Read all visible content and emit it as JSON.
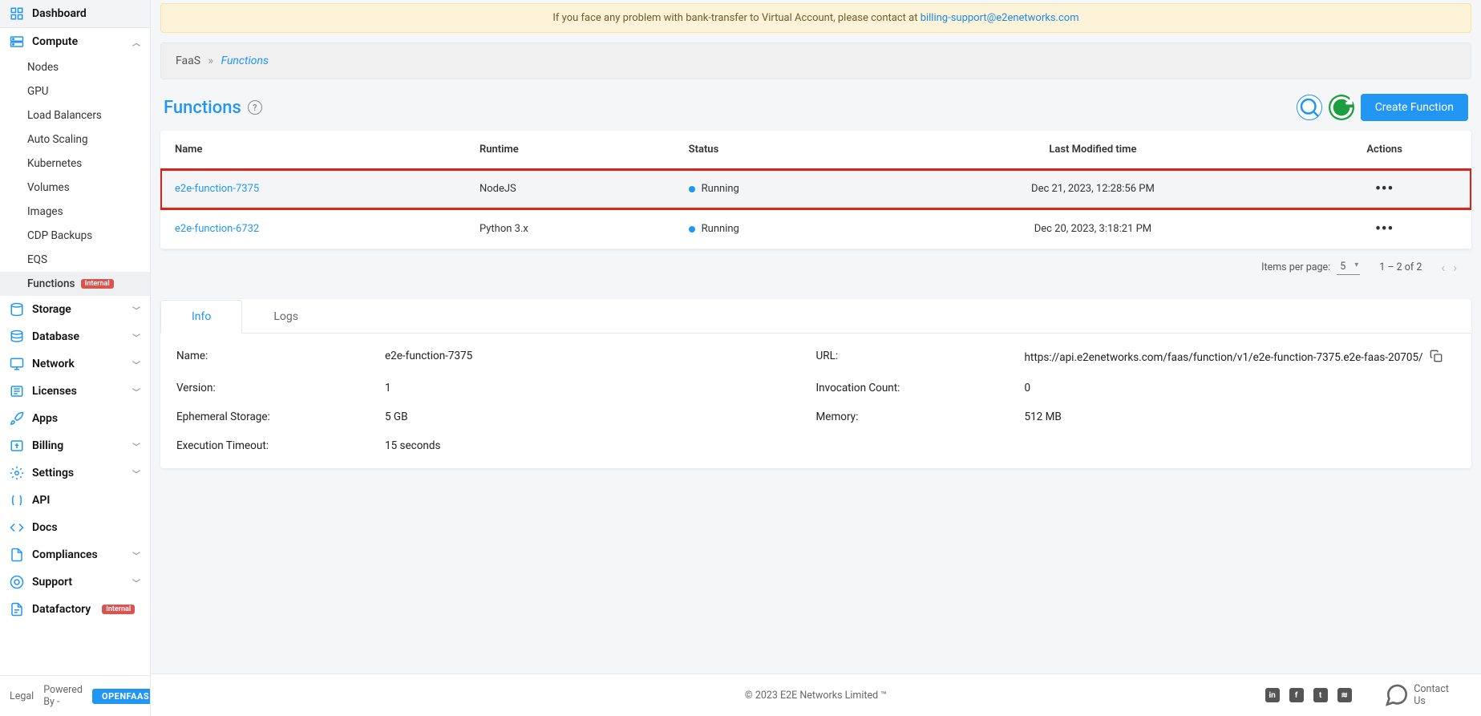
{
  "notice": {
    "text": "If you face any problem with bank-transfer to Virtual Account, please contact at ",
    "email": "billing-support@e2enetworks.com"
  },
  "sidebar": {
    "dashboard": "Dashboard",
    "compute": {
      "label": "Compute",
      "items": [
        "Nodes",
        "GPU",
        "Load Balancers",
        "Auto Scaling",
        "Kubernetes",
        "Volumes",
        "Images",
        "CDP Backups",
        "EQS",
        "Functions"
      ],
      "functions_badge": "Internal"
    },
    "storage": "Storage",
    "database": "Database",
    "network": "Network",
    "licenses": "Licenses",
    "apps": "Apps",
    "billing": "Billing",
    "settings": "Settings",
    "api": "API",
    "docs": "Docs",
    "compliances": "Compliances",
    "support": "Support",
    "datafactory": "Datafactory",
    "datafactory_badge": "Internal"
  },
  "footer_left": {
    "legal": "Legal",
    "powered": "Powered By -",
    "openfaas": "OPENFAAS"
  },
  "breadcrumb": {
    "root": "FaaS",
    "current": "Functions"
  },
  "page": {
    "title": "Functions",
    "create_btn": "Create Function"
  },
  "table": {
    "headers": {
      "name": "Name",
      "runtime": "Runtime",
      "status": "Status",
      "modified": "Last Modified time",
      "actions": "Actions"
    },
    "rows": [
      {
        "name": "e2e-function-7375",
        "runtime": "NodeJS",
        "status": "Running",
        "modified": "Dec 21, 2023, 12:28:56 PM"
      },
      {
        "name": "e2e-function-6732",
        "runtime": "Python 3.x",
        "status": "Running",
        "modified": "Dec 20, 2023, 3:18:21 PM"
      }
    ]
  },
  "pagination": {
    "label": "Items per page:",
    "per_page": "5",
    "range": "1 – 2 of 2"
  },
  "tabs": {
    "info": "Info",
    "logs": "Logs"
  },
  "detail": {
    "labels": {
      "name": "Name:",
      "url": "URL:",
      "version": "Version:",
      "invocation": "Invocation Count:",
      "storage": "Ephemeral Storage:",
      "memory": "Memory:",
      "timeout": "Execution Timeout:"
    },
    "values": {
      "name": "e2e-function-7375",
      "url": "https://api.e2enetworks.com/faas/function/v1/e2e-function-7375.e2e-faas-20705/",
      "version": "1",
      "invocation": "0",
      "storage": "5 GB",
      "memory": "512 MB",
      "timeout": "15 seconds"
    }
  },
  "app_footer": {
    "copyright": "© 2023 E2E Networks Limited ™",
    "contact": "Contact Us"
  }
}
